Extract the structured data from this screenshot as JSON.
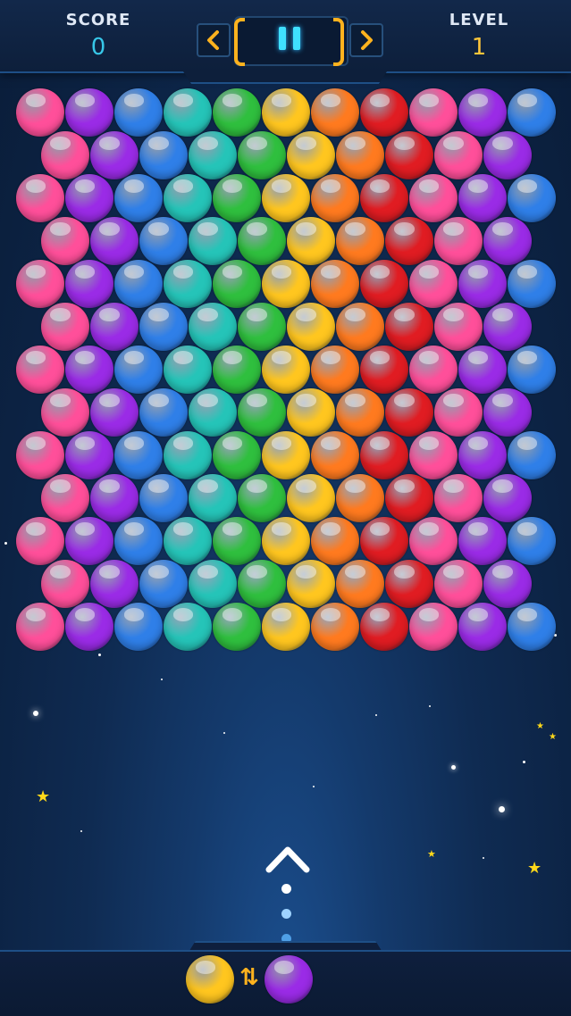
{
  "hud": {
    "score_label": "SCORE",
    "score_value": "0",
    "level_label": "LEVEL",
    "level_value": "1",
    "prev_icon": "chevron-left-icon",
    "next_icon": "chevron-right-icon",
    "pause_icon": "pause-icon"
  },
  "colors": {
    "pink": "#ff4f9a",
    "purple": "#9a2be6",
    "blue": "#2f7fe8",
    "teal": "#25c4b8",
    "green": "#2fbf3e",
    "yellow": "#ffc61f",
    "orange": "#ff7a1f",
    "red": "#e01c22",
    "accent": "#ffb21e",
    "score_color": "#37c7e8"
  },
  "board": {
    "rows": [
      [
        "pink",
        "purple",
        "blue",
        "teal",
        "green",
        "yellow",
        "orange",
        "red",
        "pink",
        "purple",
        "blue"
      ],
      [
        "pink",
        "purple",
        "blue",
        "teal",
        "green",
        "yellow",
        "orange",
        "red",
        "pink",
        "purple"
      ],
      [
        "pink",
        "purple",
        "blue",
        "teal",
        "green",
        "yellow",
        "orange",
        "red",
        "pink",
        "purple",
        "blue"
      ],
      [
        "pink",
        "purple",
        "blue",
        "teal",
        "green",
        "yellow",
        "orange",
        "red",
        "pink",
        "purple"
      ],
      [
        "pink",
        "purple",
        "blue",
        "teal",
        "green",
        "yellow",
        "orange",
        "red",
        "pink",
        "purple",
        "blue"
      ],
      [
        "pink",
        "purple",
        "blue",
        "teal",
        "green",
        "yellow",
        "orange",
        "red",
        "pink",
        "purple"
      ],
      [
        "pink",
        "purple",
        "blue",
        "teal",
        "green",
        "yellow",
        "orange",
        "red",
        "pink",
        "purple",
        "blue"
      ],
      [
        "pink",
        "purple",
        "blue",
        "teal",
        "green",
        "yellow",
        "orange",
        "red",
        "pink",
        "purple"
      ],
      [
        "pink",
        "purple",
        "blue",
        "teal",
        "green",
        "yellow",
        "orange",
        "red",
        "pink",
        "purple",
        "blue"
      ],
      [
        "pink",
        "purple",
        "blue",
        "teal",
        "green",
        "yellow",
        "orange",
        "red",
        "pink",
        "purple"
      ],
      [
        "pink",
        "purple",
        "blue",
        "teal",
        "green",
        "yellow",
        "orange",
        "red",
        "pink",
        "purple",
        "blue"
      ],
      [
        "pink",
        "purple",
        "blue",
        "teal",
        "green",
        "yellow",
        "orange",
        "red",
        "pink",
        "purple"
      ],
      [
        "pink",
        "purple",
        "blue",
        "teal",
        "green",
        "yellow",
        "orange",
        "red",
        "pink",
        "purple",
        "blue"
      ]
    ]
  },
  "shooter": {
    "current": "yellow",
    "next": "purple",
    "swap_icon": "swap-arrows-icon",
    "aim_icon": "chevron-up-icon"
  }
}
